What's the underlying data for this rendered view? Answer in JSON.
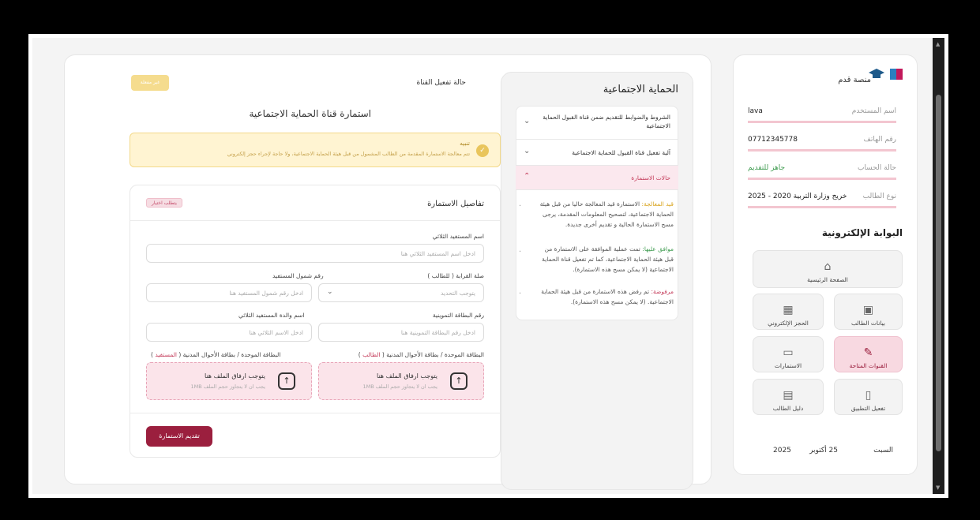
{
  "sidebar": {
    "logo_text": "منصة قدم",
    "info": [
      {
        "label": "اسم المستخدم",
        "value": "lava"
      },
      {
        "label": "رقم الهاتف",
        "value": "07712345778"
      },
      {
        "label": "حالة الحساب",
        "value": "جاهز للتقديم"
      },
      {
        "label": "نوع الطالب",
        "value": "خريج وزارة التربية 2020 - 2025"
      }
    ],
    "portal_title": "البوابة الإلكترونية",
    "tiles": {
      "home": "الصفحة الرئيسية",
      "student_data": "بيانات الطالب",
      "e_booking": "الحجز الإلكتروني",
      "channels": "القنوات المتاحة",
      "forms": "الاستمارات",
      "activate_app": "تفعيل التطبيق",
      "student_guide": "دليل الطالب"
    },
    "date": {
      "day": "السبت",
      "date": "25 أكتوبر",
      "year": "2025"
    }
  },
  "mid": {
    "title": "الحماية الاجتماعية",
    "accordion": [
      "الشروط والضوابط للتقديم ضمن قناة القبول الحماية الاجتماعية",
      "آلية تفعيل قناة القبول للحماية الاجتماعية",
      "حالات الاستمارة"
    ],
    "statuses": [
      {
        "label": "قيد المعالجة:",
        "text": "الاستمارة قيد المعالجة حاليا من قبل هيئة الحماية الاجتماعية، لتصحيح المعلومات المقدمة، يرجى مسح الاستمارة الحالية و تقديم أخرى جديدة."
      },
      {
        "label": "موافق عليها:",
        "text": "تمت عملية الموافقة على الاستمارة من قبل هيئة الحماية الاجتماعية، كما تم تفعيل قناة الحماية الاجتماعية (لا يمكن مسح هذه الاستمارة)."
      },
      {
        "label": "مرفوضة:",
        "text": "تم رفض هذه الاستمارة من قبل هيئة الحماية الاجتماعية. (لا يمكن مسح هذه الاستمارة)."
      }
    ],
    "status_colors": [
      "#d9a521",
      "#3e9b4f",
      "#c43b5a"
    ]
  },
  "main": {
    "status_title": "حالة تفعيل القناة",
    "status_badge": "غير مفعلة",
    "form_title": "استمارة قناة الحماية الاجتماعية",
    "warning_title": "تنبيه",
    "warning_msg": "تتم معالجة الاستمارة المقدمة من الطالب المشمول من قبل هيئة الحماية الاجتماعية، ولا حاجة لإجراء حجز إلكتروني",
    "details_title": "تفاصيل الاستمارة",
    "choose_badge": "يتطلب اختيار",
    "fields": {
      "beneficiary_name": {
        "label": "اسم المستفيد الثلاثي",
        "placeholder": "ادخل اسم المستفيد الثلاثي هنا"
      },
      "relation": {
        "label": "صلة القرابة ( للطالب )",
        "placeholder": "يتوجب التحديد"
      },
      "coverage_number": {
        "label": "رقم شمول المستفيد",
        "placeholder": "ادخل رقم شمول المستفيد هنا"
      },
      "ration_card": {
        "label": "رقم البطاقة التموينية",
        "placeholder": "ادخل رقم البطاقة التموينية هنا"
      },
      "mother_name": {
        "label": "اسم والدة المستفيد الثلاثي",
        "placeholder": "ادخل الاسم الثلاثي هنا"
      },
      "id_student": {
        "label_prefix": "البطاقة الموحدة / بطاقة الأحوال المدنية ( ",
        "label_hl": "الطالب",
        "label_suffix": " )"
      },
      "id_beneficiary": {
        "label_prefix": "البطاقة الموحدة / بطاقة الأحوال المدنية ( ",
        "label_hl": "المستفيد",
        "label_suffix": " )"
      }
    },
    "upload": {
      "title": "يتوجب ارفاق الملف هنا",
      "subtitle": "يجب ان لا يتجاوز حجم الملف 1MB"
    },
    "submit": "تقديم الاستمارة"
  },
  "colors": {
    "accent": "#9b1f3e",
    "badge_yellow": "#f5dc8e",
    "upload_bg": "#fbe4ea"
  }
}
